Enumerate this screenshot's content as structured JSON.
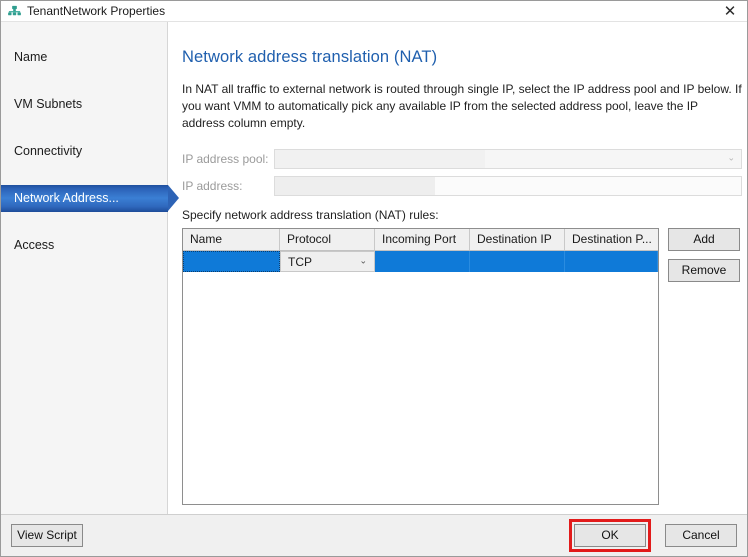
{
  "window": {
    "title": "TenantNetwork Properties",
    "icon": "network-icon",
    "close_label": "✕"
  },
  "sidebar": {
    "items": [
      {
        "label": "Name",
        "name": "sidebar-item-name",
        "selected": false
      },
      {
        "label": "VM Subnets",
        "name": "sidebar-item-vm-subnets",
        "selected": false
      },
      {
        "label": "Connectivity",
        "name": "sidebar-item-connectivity",
        "selected": false
      },
      {
        "label": "Network Address...",
        "name": "sidebar-item-network-address",
        "selected": true
      },
      {
        "label": "Access",
        "name": "sidebar-item-access",
        "selected": false
      }
    ]
  },
  "main": {
    "heading": "Network address translation (NAT)",
    "description": "In NAT all traffic to external network is routed through single IP, select the IP address pool and IP below. If you want VMM to automatically pick any available IP from the selected address pool, leave the IP address column empty.",
    "fields": {
      "ip_pool_label": "IP address pool:",
      "ip_pool_value": "",
      "ip_pool_placeholder": "",
      "ip_pool_arrow": "⌄",
      "ip_address_label": "IP address:",
      "ip_address_value": "",
      "ip_address_placeholder": ""
    },
    "rules_caption": "Specify network address translation (NAT) rules:",
    "grid": {
      "columns": [
        "Name",
        "Protocol",
        "Incoming Port",
        "Destination IP",
        "Destination P..."
      ],
      "rows": [
        {
          "name": "",
          "protocol": "TCP",
          "protocol_arrow": "⌄",
          "incoming_port": "",
          "destination_ip": "",
          "destination_port": "",
          "selected": true
        }
      ]
    },
    "buttons": {
      "add": "Add",
      "remove": "Remove"
    }
  },
  "footer": {
    "view_script": "View Script",
    "ok": "OK",
    "cancel": "Cancel"
  },
  "colors": {
    "accent_blue": "#0f7ad8",
    "heading_blue": "#1f5fae",
    "nav_selected": "#2d63b6",
    "highlight_red": "#e21b1b"
  }
}
